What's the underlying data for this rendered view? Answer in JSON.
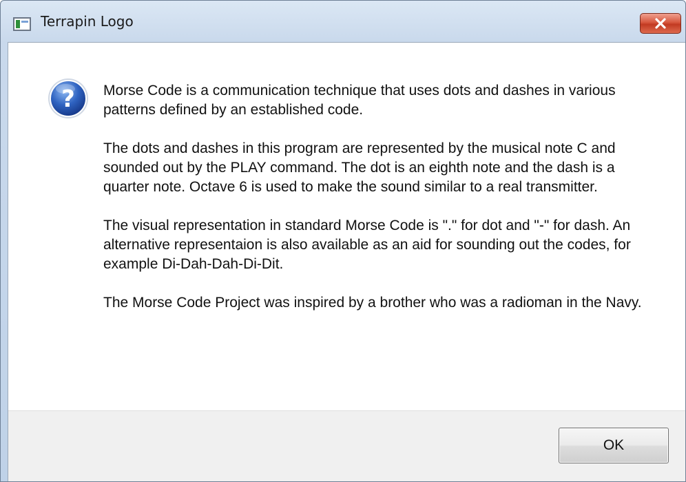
{
  "window": {
    "title": "Terrapin Logo"
  },
  "titlebar": {
    "app_icon": "terrapin-logo-app-icon",
    "close_icon": "close-icon",
    "close_color": "#c8442b"
  },
  "dialog": {
    "icon": "question-icon",
    "icon_color": "#2a5cb8",
    "paragraphs": [
      "Morse Code is a communication technique that uses dots and dashes in various patterns defined by an established code.",
      "The dots and dashes in this program are represented by the musical note C and sounded out by the PLAY command. The dot is an eighth note and the dash is a quarter note. Octave 6 is used to make the sound similar to a real transmitter.",
      "The visual representation in standard Morse Code is \".\" for dot and \"-\" for dash. An alternative representaion is also available as an aid for sounding out the codes, for example Di-Dah-Dah-Di-Dit.",
      "The Morse Code Project was inspired by a brother who was a radioman in the Navy."
    ]
  },
  "buttons": {
    "ok_label": "OK"
  }
}
